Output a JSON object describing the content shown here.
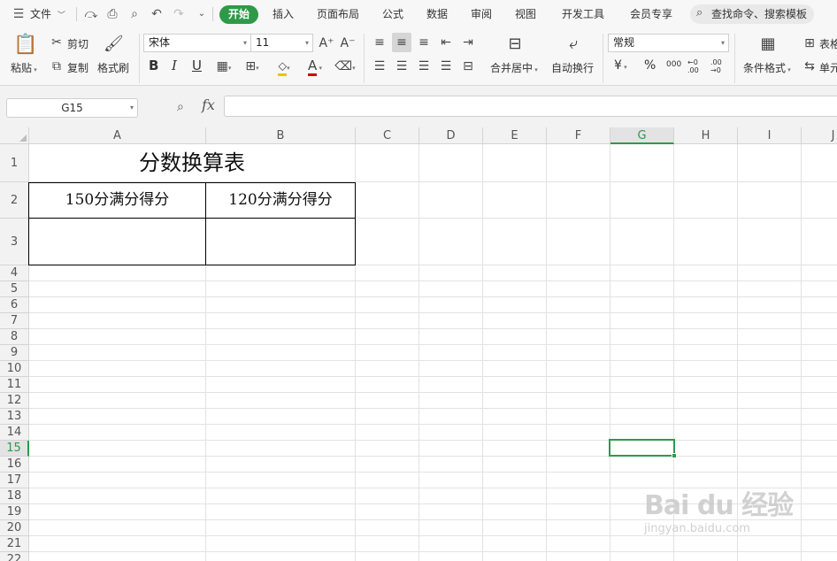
{
  "menubar": {
    "file": "文件",
    "tabs": [
      "开始",
      "插入",
      "页面布局",
      "公式",
      "数据",
      "审阅",
      "视图",
      "开发工具",
      "会员专享"
    ],
    "search_placeholder": "查找命令、搜索模板"
  },
  "ribbon": {
    "paste": "粘贴",
    "cut": "剪切",
    "copy": "复制",
    "format_painter": "格式刷",
    "font_name": "宋体",
    "font_size": "11",
    "bold": "B",
    "italic": "I",
    "underline": "U",
    "font_color_glyph": "A",
    "merge_center": "合并居中",
    "wrap_text": "自动换行",
    "number_format": "常规",
    "currency": "¥",
    "percent": "%",
    "thousands": "000",
    "dec_increase": "←0 .00",
    "dec_decrease": ".00 →0",
    "conditional_format": "条件格式",
    "table_style": "表格",
    "cell": "单元"
  },
  "formula_bar": {
    "name_box": "G15",
    "fx": "fx",
    "formula": ""
  },
  "grid": {
    "columns": [
      "A",
      "B",
      "C",
      "D",
      "E",
      "F",
      "G",
      "H",
      "I",
      "J"
    ],
    "selected_column": "G",
    "rows": [
      "1",
      "2",
      "3",
      "4",
      "5",
      "6",
      "7",
      "8",
      "9",
      "10",
      "11",
      "12",
      "13",
      "14",
      "15",
      "16",
      "17",
      "18",
      "19",
      "20",
      "21",
      "22"
    ],
    "selected_row": "15",
    "cells": {
      "A1": "分数换算表",
      "A2": "150分满分得分",
      "B2": "120分满分得分",
      "A3": "",
      "B3": ""
    }
  },
  "watermark": {
    "main": "Bai du 经验",
    "sub": "jingyan.baidu.com"
  },
  "colors": {
    "accent": "#2e9a48",
    "grid_line": "#e2e2e2",
    "header_bg": "#f2f2f2"
  }
}
